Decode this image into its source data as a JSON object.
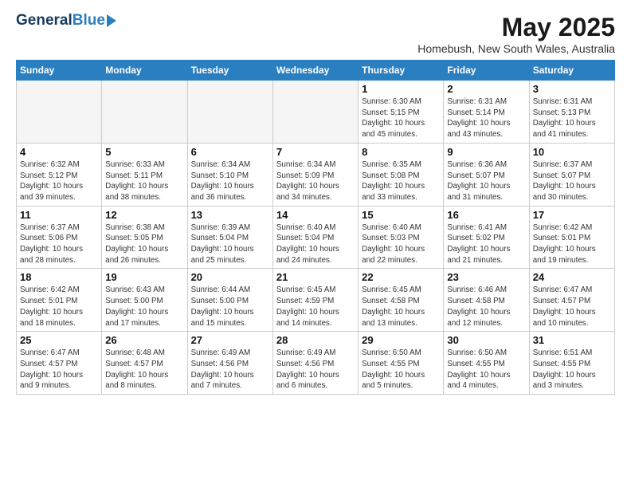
{
  "header": {
    "logo_general": "General",
    "logo_blue": "Blue",
    "month_title": "May 2025",
    "location": "Homebush, New South Wales, Australia"
  },
  "days_of_week": [
    "Sunday",
    "Monday",
    "Tuesday",
    "Wednesday",
    "Thursday",
    "Friday",
    "Saturday"
  ],
  "weeks": [
    [
      {
        "day": "",
        "info": ""
      },
      {
        "day": "",
        "info": ""
      },
      {
        "day": "",
        "info": ""
      },
      {
        "day": "",
        "info": ""
      },
      {
        "day": "1",
        "info": "Sunrise: 6:30 AM\nSunset: 5:15 PM\nDaylight: 10 hours\nand 45 minutes."
      },
      {
        "day": "2",
        "info": "Sunrise: 6:31 AM\nSunset: 5:14 PM\nDaylight: 10 hours\nand 43 minutes."
      },
      {
        "day": "3",
        "info": "Sunrise: 6:31 AM\nSunset: 5:13 PM\nDaylight: 10 hours\nand 41 minutes."
      }
    ],
    [
      {
        "day": "4",
        "info": "Sunrise: 6:32 AM\nSunset: 5:12 PM\nDaylight: 10 hours\nand 39 minutes."
      },
      {
        "day": "5",
        "info": "Sunrise: 6:33 AM\nSunset: 5:11 PM\nDaylight: 10 hours\nand 38 minutes."
      },
      {
        "day": "6",
        "info": "Sunrise: 6:34 AM\nSunset: 5:10 PM\nDaylight: 10 hours\nand 36 minutes."
      },
      {
        "day": "7",
        "info": "Sunrise: 6:34 AM\nSunset: 5:09 PM\nDaylight: 10 hours\nand 34 minutes."
      },
      {
        "day": "8",
        "info": "Sunrise: 6:35 AM\nSunset: 5:08 PM\nDaylight: 10 hours\nand 33 minutes."
      },
      {
        "day": "9",
        "info": "Sunrise: 6:36 AM\nSunset: 5:07 PM\nDaylight: 10 hours\nand 31 minutes."
      },
      {
        "day": "10",
        "info": "Sunrise: 6:37 AM\nSunset: 5:07 PM\nDaylight: 10 hours\nand 30 minutes."
      }
    ],
    [
      {
        "day": "11",
        "info": "Sunrise: 6:37 AM\nSunset: 5:06 PM\nDaylight: 10 hours\nand 28 minutes."
      },
      {
        "day": "12",
        "info": "Sunrise: 6:38 AM\nSunset: 5:05 PM\nDaylight: 10 hours\nand 26 minutes."
      },
      {
        "day": "13",
        "info": "Sunrise: 6:39 AM\nSunset: 5:04 PM\nDaylight: 10 hours\nand 25 minutes."
      },
      {
        "day": "14",
        "info": "Sunrise: 6:40 AM\nSunset: 5:04 PM\nDaylight: 10 hours\nand 24 minutes."
      },
      {
        "day": "15",
        "info": "Sunrise: 6:40 AM\nSunset: 5:03 PM\nDaylight: 10 hours\nand 22 minutes."
      },
      {
        "day": "16",
        "info": "Sunrise: 6:41 AM\nSunset: 5:02 PM\nDaylight: 10 hours\nand 21 minutes."
      },
      {
        "day": "17",
        "info": "Sunrise: 6:42 AM\nSunset: 5:01 PM\nDaylight: 10 hours\nand 19 minutes."
      }
    ],
    [
      {
        "day": "18",
        "info": "Sunrise: 6:42 AM\nSunset: 5:01 PM\nDaylight: 10 hours\nand 18 minutes."
      },
      {
        "day": "19",
        "info": "Sunrise: 6:43 AM\nSunset: 5:00 PM\nDaylight: 10 hours\nand 17 minutes."
      },
      {
        "day": "20",
        "info": "Sunrise: 6:44 AM\nSunset: 5:00 PM\nDaylight: 10 hours\nand 15 minutes."
      },
      {
        "day": "21",
        "info": "Sunrise: 6:45 AM\nSunset: 4:59 PM\nDaylight: 10 hours\nand 14 minutes."
      },
      {
        "day": "22",
        "info": "Sunrise: 6:45 AM\nSunset: 4:58 PM\nDaylight: 10 hours\nand 13 minutes."
      },
      {
        "day": "23",
        "info": "Sunrise: 6:46 AM\nSunset: 4:58 PM\nDaylight: 10 hours\nand 12 minutes."
      },
      {
        "day": "24",
        "info": "Sunrise: 6:47 AM\nSunset: 4:57 PM\nDaylight: 10 hours\nand 10 minutes."
      }
    ],
    [
      {
        "day": "25",
        "info": "Sunrise: 6:47 AM\nSunset: 4:57 PM\nDaylight: 10 hours\nand 9 minutes."
      },
      {
        "day": "26",
        "info": "Sunrise: 6:48 AM\nSunset: 4:57 PM\nDaylight: 10 hours\nand 8 minutes."
      },
      {
        "day": "27",
        "info": "Sunrise: 6:49 AM\nSunset: 4:56 PM\nDaylight: 10 hours\nand 7 minutes."
      },
      {
        "day": "28",
        "info": "Sunrise: 6:49 AM\nSunset: 4:56 PM\nDaylight: 10 hours\nand 6 minutes."
      },
      {
        "day": "29",
        "info": "Sunrise: 6:50 AM\nSunset: 4:55 PM\nDaylight: 10 hours\nand 5 minutes."
      },
      {
        "day": "30",
        "info": "Sunrise: 6:50 AM\nSunset: 4:55 PM\nDaylight: 10 hours\nand 4 minutes."
      },
      {
        "day": "31",
        "info": "Sunrise: 6:51 AM\nSunset: 4:55 PM\nDaylight: 10 hours\nand 3 minutes."
      }
    ]
  ]
}
